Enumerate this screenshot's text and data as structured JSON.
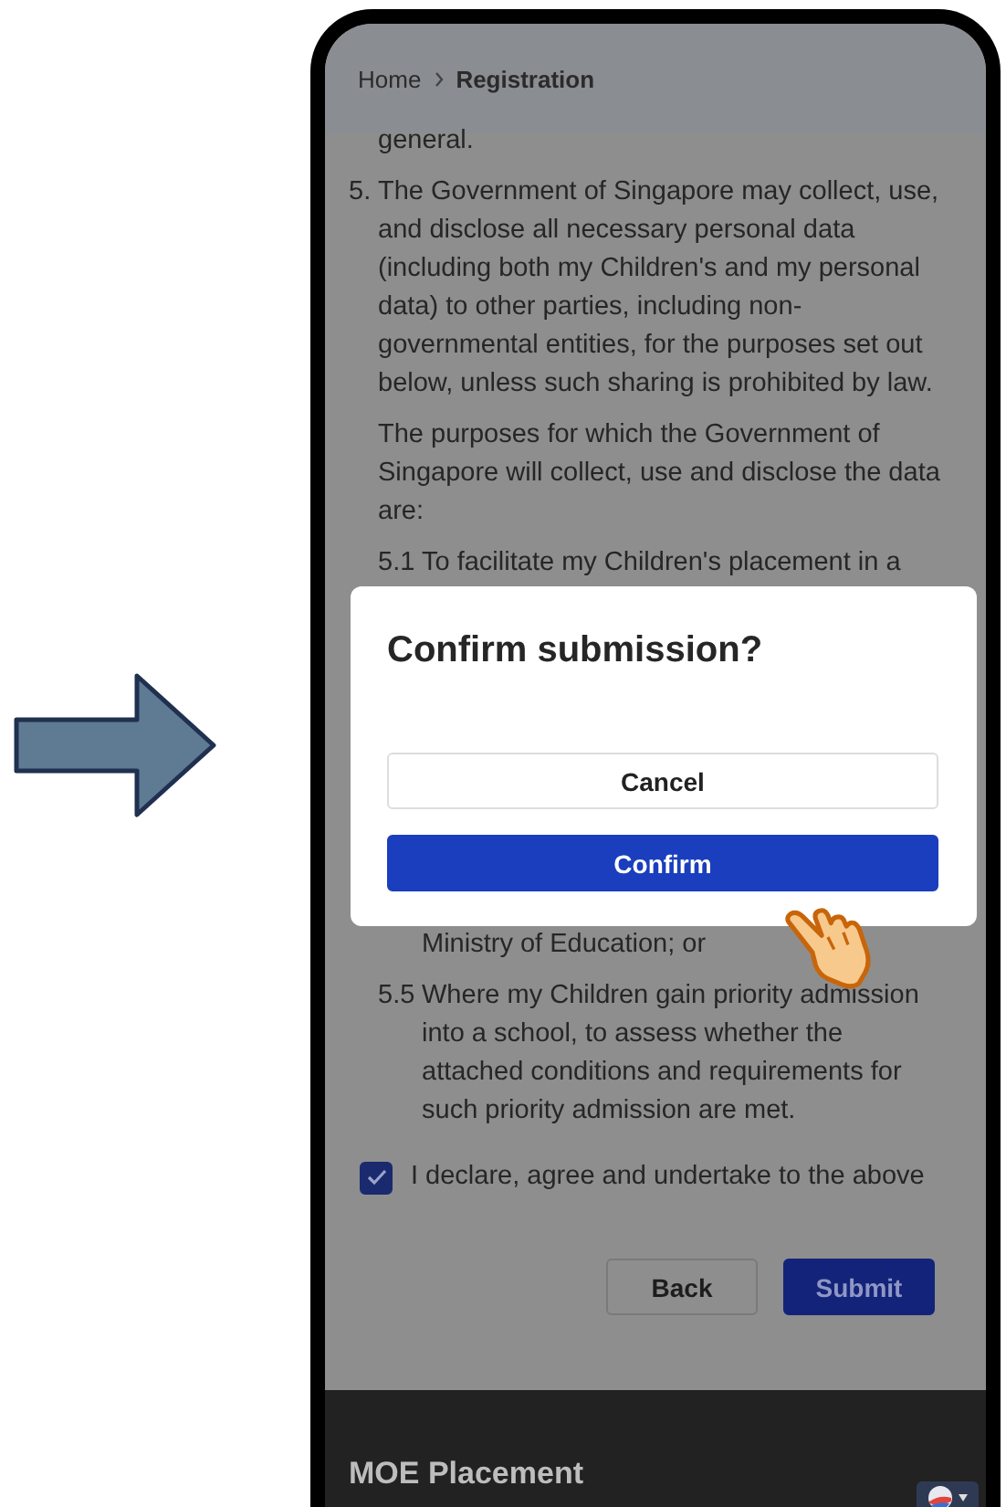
{
  "breadcrumb": {
    "items": [
      "Home",
      "Registration"
    ]
  },
  "content": [
    {
      "kind": "text",
      "text": "general."
    },
    {
      "kind": "numbered",
      "number": "5.",
      "text": "The Government of Singapore may collect, use, and disclose all necessary personal data (including both my Children's and my personal data) to other parties, including non-governmental entities, for the purposes set out below, unless such sharing is prohibited by law."
    },
    {
      "kind": "text",
      "text": "The purposes for which the Government of Singapore will collect, use and disclose the data are:"
    },
    {
      "kind": "subitem",
      "number": "5.1",
      "text": "To facilitate my Children's placement in a"
    },
    {
      "kind": "continuation",
      "text": "Ministry of Education; or"
    },
    {
      "kind": "subitem",
      "number": "5.5",
      "text": "Where my Children gain priority admission into a school, to assess whether the attached conditions and requirements for such priority admission are met."
    }
  ],
  "declaration": {
    "label": "I declare, agree and undertake to the above",
    "checked": true
  },
  "actions": [
    {
      "label": "Back",
      "kind": "secondary"
    },
    {
      "label": "Submit",
      "kind": "primary"
    }
  ],
  "footer": {
    "title": "MOE Placement"
  },
  "dialog": {
    "title": "Confirm submission?",
    "buttons": [
      {
        "label": "Cancel",
        "kind": "secondary"
      },
      {
        "label": "Confirm",
        "kind": "primary"
      }
    ]
  }
}
